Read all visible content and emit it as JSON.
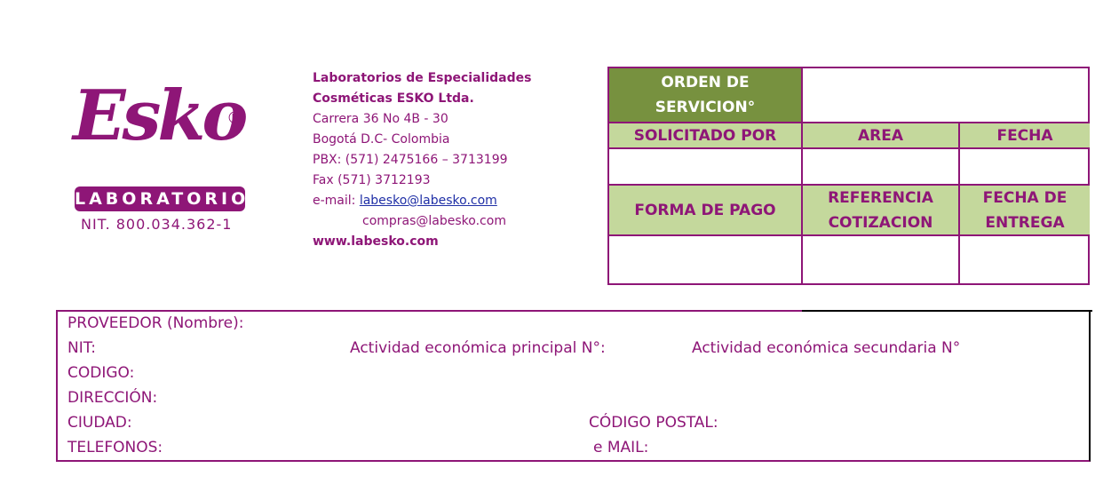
{
  "logo": {
    "brand": "Esko",
    "registered_mark": "®",
    "banner": "LABORATORIOS",
    "nit": "NIT. 800.034.362-1"
  },
  "company": {
    "name_line1": "Laboratorios de Especialidades",
    "name_line2": "Cosméticas ESKO Ltda.",
    "address": "Carrera 36 No 4B - 30",
    "city": "Bogotá D.C- Colombia",
    "pbx": "PBX: (571) 2475166 – 3713199",
    "fax": "Fax (571) 3712193",
    "email_label": "e-mail: ",
    "email1": "labesko@labesko.com",
    "email2": "compras@labesko.com",
    "website": "www.labesko.com"
  },
  "order": {
    "title_line1": "ORDEN DE",
    "title_line2": "SERVICION°",
    "title_value": "",
    "header1": [
      "SOLICITADO POR",
      "AREA",
      "FECHA"
    ],
    "values1": [
      "",
      "",
      ""
    ],
    "header2_col1": "FORMA DE PAGO",
    "header2_col2_line1": "REFERENCIA",
    "header2_col2_line2": "COTIZACION",
    "header2_col3_line1": "FECHA DE",
    "header2_col3_line2": "ENTREGA",
    "values2": [
      "",
      "",
      ""
    ]
  },
  "provider": {
    "name_label": "PROVEEDOR (Nombre):",
    "nit_label": "NIT:",
    "activity_primary_label": "Actividad económica principal N°:",
    "activity_secondary_label": "Actividad económica secundaria N°",
    "code_label": "CODIGO:",
    "address_label": "DIRECCIÓN:",
    "city_label": "CIUDAD:",
    "postal_code_label": "CÓDIGO POSTAL:",
    "phones_label": "TELEFONOS:",
    "email_label": "e MAIL:"
  },
  "colors": {
    "brand_purple": "#8e1677",
    "header_dark_green": "#77913f",
    "header_light_green": "#c4d89c",
    "link_blue": "#1f2fa6"
  }
}
